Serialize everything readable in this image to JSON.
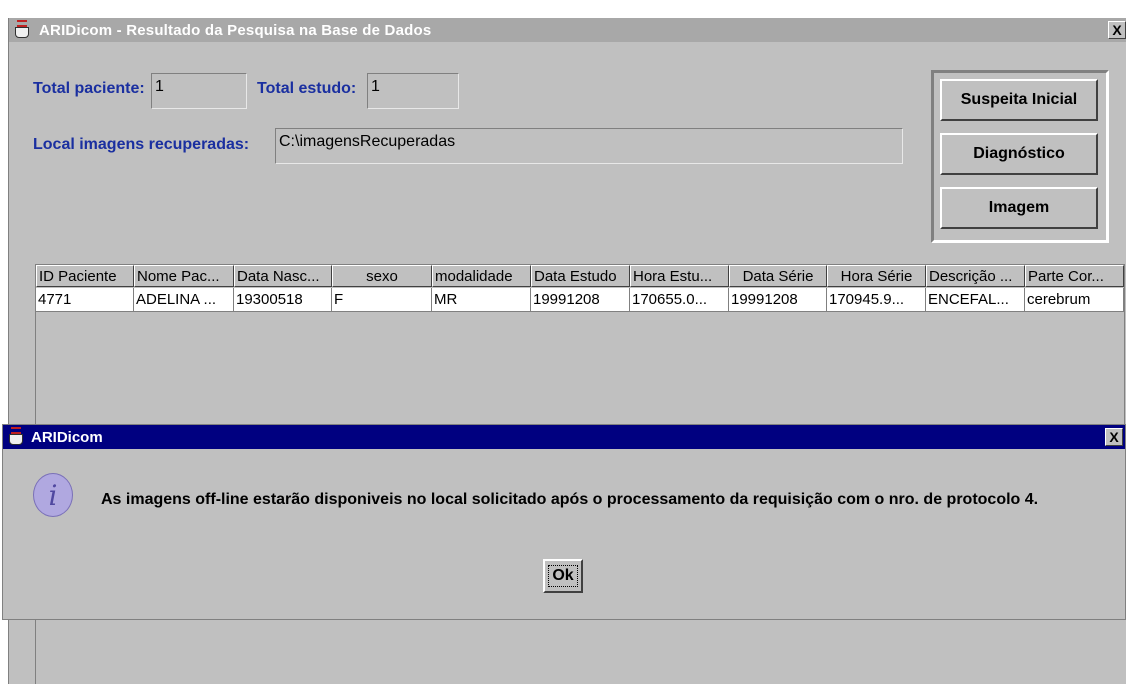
{
  "main_window": {
    "title": "ARIDicom - Resultado da Pesquisa na Base de Dados",
    "close_label": "X"
  },
  "fields": {
    "total_paciente_label": "Total paciente:",
    "total_paciente_value": "1",
    "total_estudo_label": "Total estudo:",
    "total_estudo_value": "1",
    "local_label": "Local imagens recuperadas:",
    "local_value": "C:\\imagensRecuperadas"
  },
  "buttons": {
    "suspeita": "Suspeita Inicial",
    "diagnostico": "Diagnóstico",
    "imagem": "Imagem"
  },
  "table": {
    "columns": [
      "ID Paciente",
      "Nome Pac...",
      "Data Nasc...",
      "sexo",
      "modalidade",
      "Data Estudo",
      "Hora Estu...",
      "Data Série",
      "Hora Série",
      "Descrição ...",
      "Parte Cor..."
    ],
    "rows": [
      [
        "4771",
        "ADELINA ...",
        "19300518",
        "F",
        "MR",
        "19991208",
        "170655.0...",
        "19991208",
        "170945.9...",
        "ENCEFAL...",
        "cerebrum"
      ]
    ]
  },
  "dialog": {
    "title": "ARIDicom",
    "close_label": "X",
    "message": "As imagens off-line estarão disponiveis no local solicitado após o processamento da requisição com o nro. de protocolo 4.",
    "ok_label": "Ok"
  }
}
